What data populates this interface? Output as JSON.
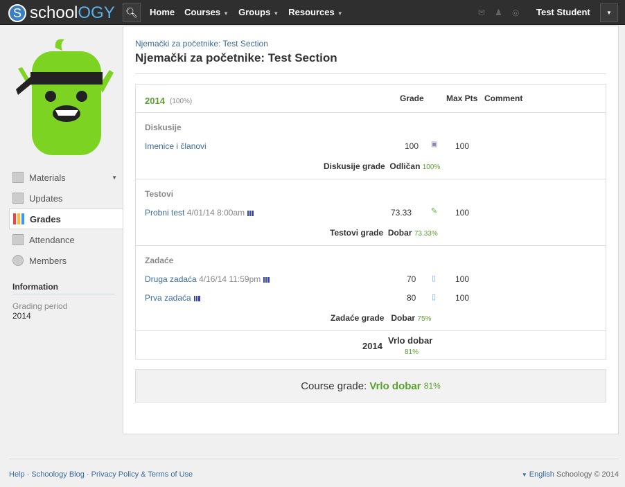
{
  "header": {
    "logo_s": "S",
    "logo_school": "school",
    "logo_ogy": "OGY",
    "nav": [
      "Home",
      "Courses",
      "Groups",
      "Resources"
    ],
    "user": "Test Student"
  },
  "sidebar": {
    "items": [
      "Materials",
      "Updates",
      "Grades",
      "Attendance",
      "Members"
    ],
    "info_title": "Information",
    "grading_label": "Grading period",
    "grading_value": "2014"
  },
  "main": {
    "breadcrumb": "Njemački za početnike: Test Section",
    "title": "Njemački za početnike: Test Section",
    "period": "2014",
    "period_weight": "(100%)",
    "col_grade": "Grade",
    "col_max": "Max Pts",
    "col_comment": "Comment",
    "categories": [
      {
        "name": "Diskusije",
        "items": [
          {
            "title": "Imenice i članovi",
            "date": "",
            "grade": "100",
            "max": "100"
          }
        ],
        "total_label": "Diskusije grade",
        "total_grade": "Odličan",
        "total_pct": "100%"
      },
      {
        "name": "Testovi",
        "items": [
          {
            "title": "Probni test",
            "date": "4/01/14 8:00am",
            "grade": "73.33",
            "max": "100"
          }
        ],
        "total_label": "Testovi grade",
        "total_grade": "Dobar",
        "total_pct": "73.33%"
      },
      {
        "name": "Zadaće",
        "items": [
          {
            "title": "Druga zadaća",
            "date": "4/16/14 11:59pm",
            "grade": "70",
            "max": "100"
          },
          {
            "title": "Prva zadaća",
            "date": "",
            "grade": "80",
            "max": "100"
          }
        ],
        "total_label": "Zadaće grade",
        "total_grade": "Dobar",
        "total_pct": "75%"
      }
    ],
    "period_total_label": "2014",
    "period_total_grade": "Vrlo dobar",
    "period_total_pct": "81%",
    "course_grade_label": "Course grade:",
    "course_grade": "Vrlo dobar",
    "course_pct": "81%"
  },
  "footer": {
    "links": [
      "Help",
      "Schoology Blog",
      "Privacy Policy & Terms of Use"
    ],
    "language": "English",
    "copyright": "Schoology © 2014"
  },
  "colors": {
    "accent": "#5aa02c",
    "link": "#3b6b9c",
    "topbar": "#2f2f2f"
  }
}
